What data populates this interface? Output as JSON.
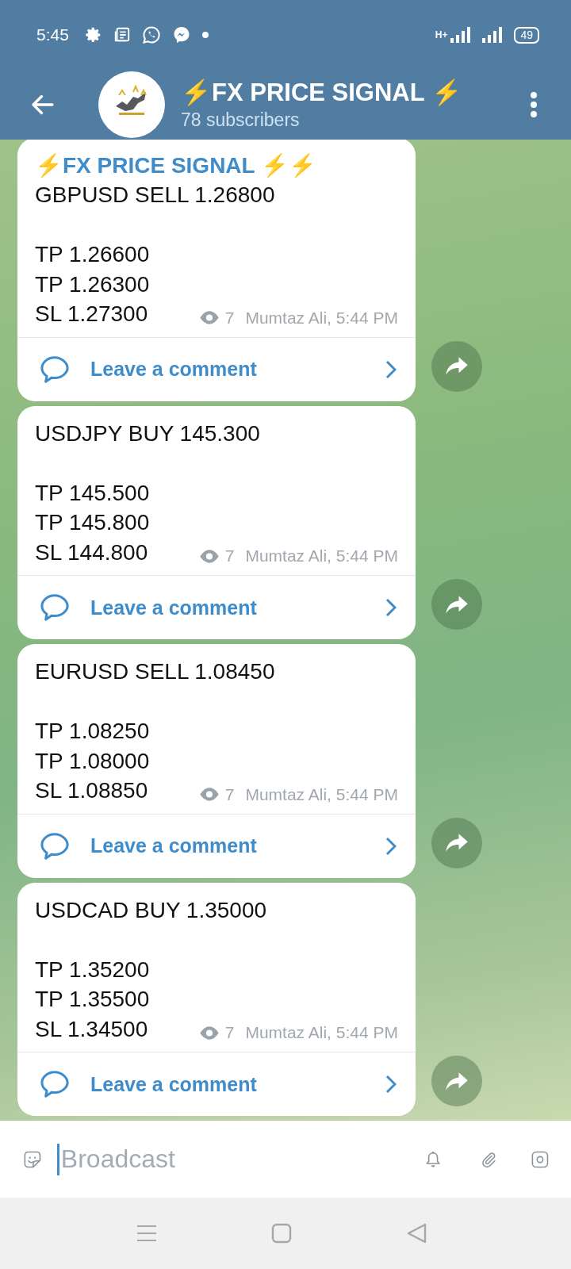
{
  "status_bar": {
    "time": "5:45",
    "network": "H+",
    "battery": "49"
  },
  "header": {
    "title": "⚡FX PRICE SIGNAL ⚡",
    "subtitle": "78 subscribers"
  },
  "messages": [
    {
      "signature": "⚡FX PRICE SIGNAL ⚡⚡",
      "title": "GBPUSD SELL 1.26800",
      "targets": [
        "TP 1.26600",
        "TP 1.26300"
      ],
      "stop": "SL 1.27300",
      "views": "7",
      "author_time": "Mumtaz Ali, 5:44 PM",
      "comment": "Leave a comment"
    },
    {
      "title": "USDJPY BUY 145.300",
      "targets": [
        "TP 145.500",
        "TP 145.800"
      ],
      "stop": "SL 144.800",
      "views": "7",
      "author_time": "Mumtaz Ali, 5:44 PM",
      "comment": "Leave a comment"
    },
    {
      "title": "EURUSD SELL 1.08450",
      "targets": [
        "TP 1.08250",
        "TP 1.08000"
      ],
      "stop": "SL 1.08850",
      "views": "7",
      "author_time": "Mumtaz Ali, 5:44 PM",
      "comment": "Leave a comment"
    },
    {
      "title": "USDCAD BUY 1.35000",
      "targets": [
        "TP 1.35200",
        "TP 1.35500"
      ],
      "stop": "SL 1.34500",
      "views": "7",
      "author_time": "Mumtaz Ali, 5:44 PM",
      "comment": "Leave a comment"
    }
  ],
  "composer": {
    "placeholder": "Broadcast"
  }
}
